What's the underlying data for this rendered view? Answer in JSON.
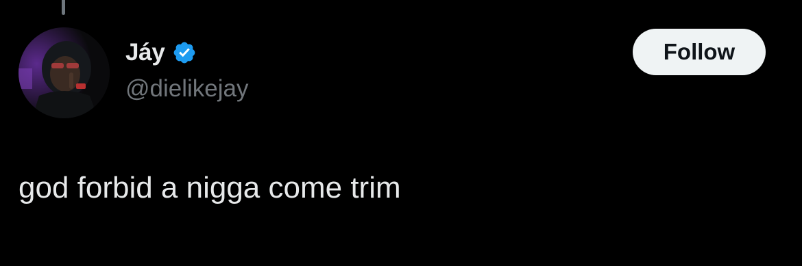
{
  "tweet": {
    "author": {
      "display_name": "Jáy",
      "handle": "@dielikejay",
      "verified": true,
      "verified_icon": "verified-badge-icon"
    },
    "follow_label": "Follow",
    "text": "god forbid a nigga come trim"
  },
  "colors": {
    "background": "#000000",
    "primary_text": "#e7e9ea",
    "secondary_text": "#71767b",
    "verified_blue": "#1d9bf0",
    "follow_bg": "#eff3f4",
    "follow_text": "#0f1419"
  }
}
